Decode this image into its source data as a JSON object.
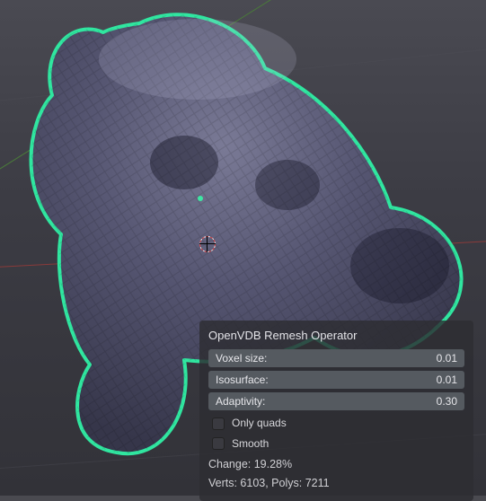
{
  "panel": {
    "title": "OpenVDB Remesh Operator",
    "sliders": [
      {
        "label": "Voxel size:",
        "value": "0.01"
      },
      {
        "label": "Isosurface:",
        "value": "0.01"
      },
      {
        "label": "Adaptivity:",
        "value": "0.30"
      }
    ],
    "checkboxes": [
      {
        "label": "Only quads",
        "checked": false
      },
      {
        "label": "Smooth",
        "checked": false
      }
    ],
    "change_label": "Change: 19.28%",
    "stats_label": "Verts: 6103, Polys: 7211"
  },
  "viewport": {
    "selection_outline_color": "#30e6a0",
    "mesh_fill_color": "#5a5a72",
    "axes": {
      "x": "#8a3a3a",
      "y": "#4a7a3a"
    }
  },
  "chart_data": {
    "type": "table",
    "title": "OpenVDB Remesh Operator",
    "properties": [
      {
        "name": "Voxel size",
        "value": 0.01
      },
      {
        "name": "Isosurface",
        "value": 0.01
      },
      {
        "name": "Adaptivity",
        "value": 0.3
      },
      {
        "name": "Only quads",
        "value": false
      },
      {
        "name": "Smooth",
        "value": false
      }
    ],
    "results": {
      "change_percent": 19.28,
      "verts": 6103,
      "polys": 7211
    }
  }
}
